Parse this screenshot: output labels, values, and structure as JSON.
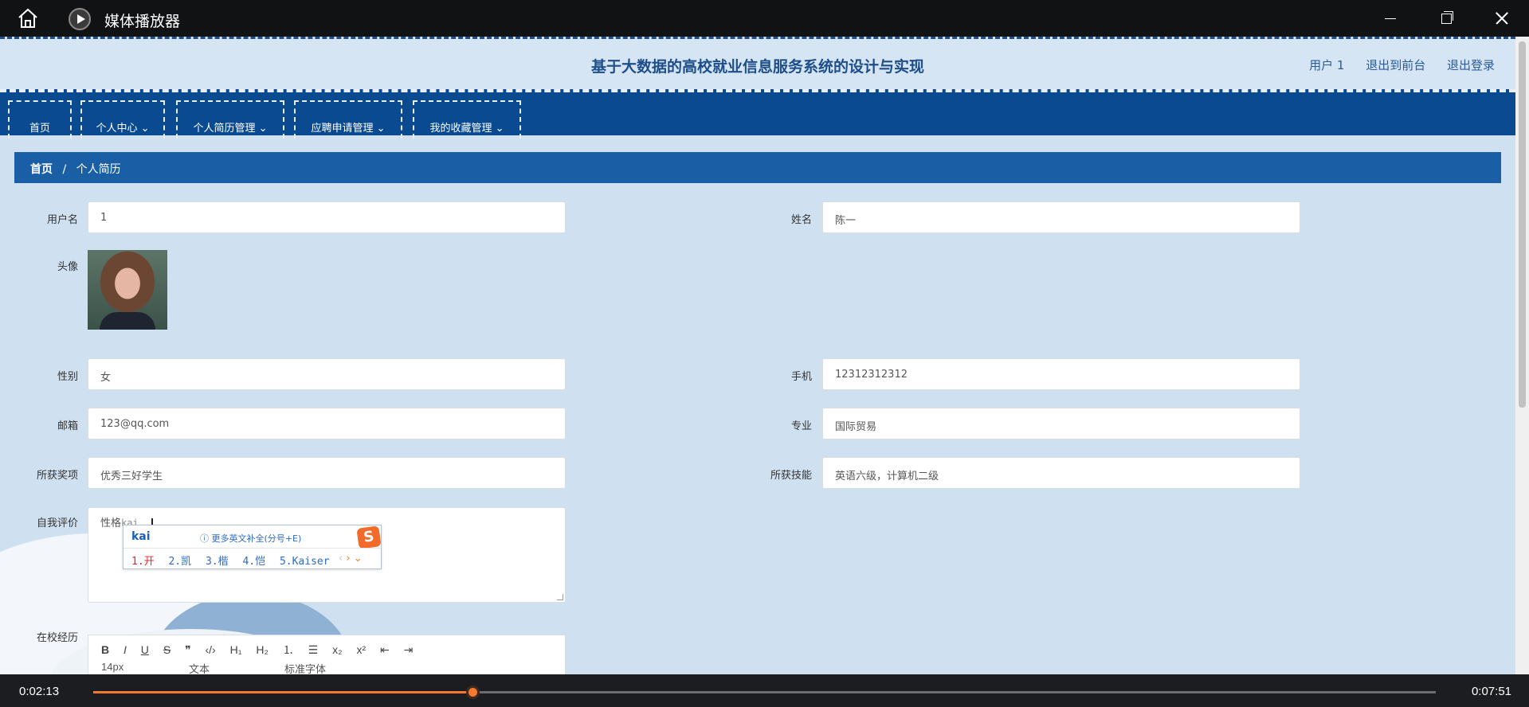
{
  "player": {
    "title": "媒体播放器",
    "current_time": "0:02:13",
    "total_time": "0:07:51",
    "progress_fraction": 0.2825
  },
  "site": {
    "title": "基于大数据的高校就业信息服务系统的设计与实现",
    "links": [
      "用户 1",
      "退出到前台",
      "退出登录"
    ]
  },
  "nav": {
    "items": [
      "首页",
      "个人中心 ⌄",
      "个人简历管理 ⌄",
      "应聘申请管理 ⌄",
      "我的收藏管理 ⌄"
    ]
  },
  "breadcrumb": {
    "home": "首页",
    "sep": "/",
    "current": "个人简历"
  },
  "form": {
    "username": {
      "label": "用户名",
      "value": "1"
    },
    "name": {
      "label": "姓名",
      "value": "陈一"
    },
    "avatar": {
      "label": "头像"
    },
    "gender": {
      "label": "性别",
      "value": "女"
    },
    "phone": {
      "label": "手机",
      "value": "12312312312"
    },
    "email": {
      "label": "邮箱",
      "value": "123@qq.com"
    },
    "major": {
      "label": "专业",
      "value": "国际贸易"
    },
    "awards": {
      "label": "所获奖项",
      "value": "优秀三好学生"
    },
    "skills": {
      "label": "所获技能",
      "value": "英语六级，计算机二级"
    },
    "self_eval": {
      "label": "自我评价",
      "value": "性格",
      "typed": "kai"
    },
    "campus": {
      "label": "在校经历"
    }
  },
  "ime": {
    "composition": "kai",
    "hint": "ⓘ 更多英文补全(分号+E)",
    "candidates": [
      "1.开",
      "2.凯",
      "3.楷",
      "4.恺",
      "5.Kaiser"
    ],
    "logo": "S"
  },
  "editor": {
    "toolbar": [
      "B",
      "I",
      "U",
      "S",
      "❞",
      "‹/›",
      "H₁",
      "H₂",
      "⒈",
      "☰",
      "x₂",
      "x²",
      "⇤",
      "⇥"
    ],
    "font_size": "14px",
    "block_type": "文本",
    "font_family": "标准字体"
  }
}
